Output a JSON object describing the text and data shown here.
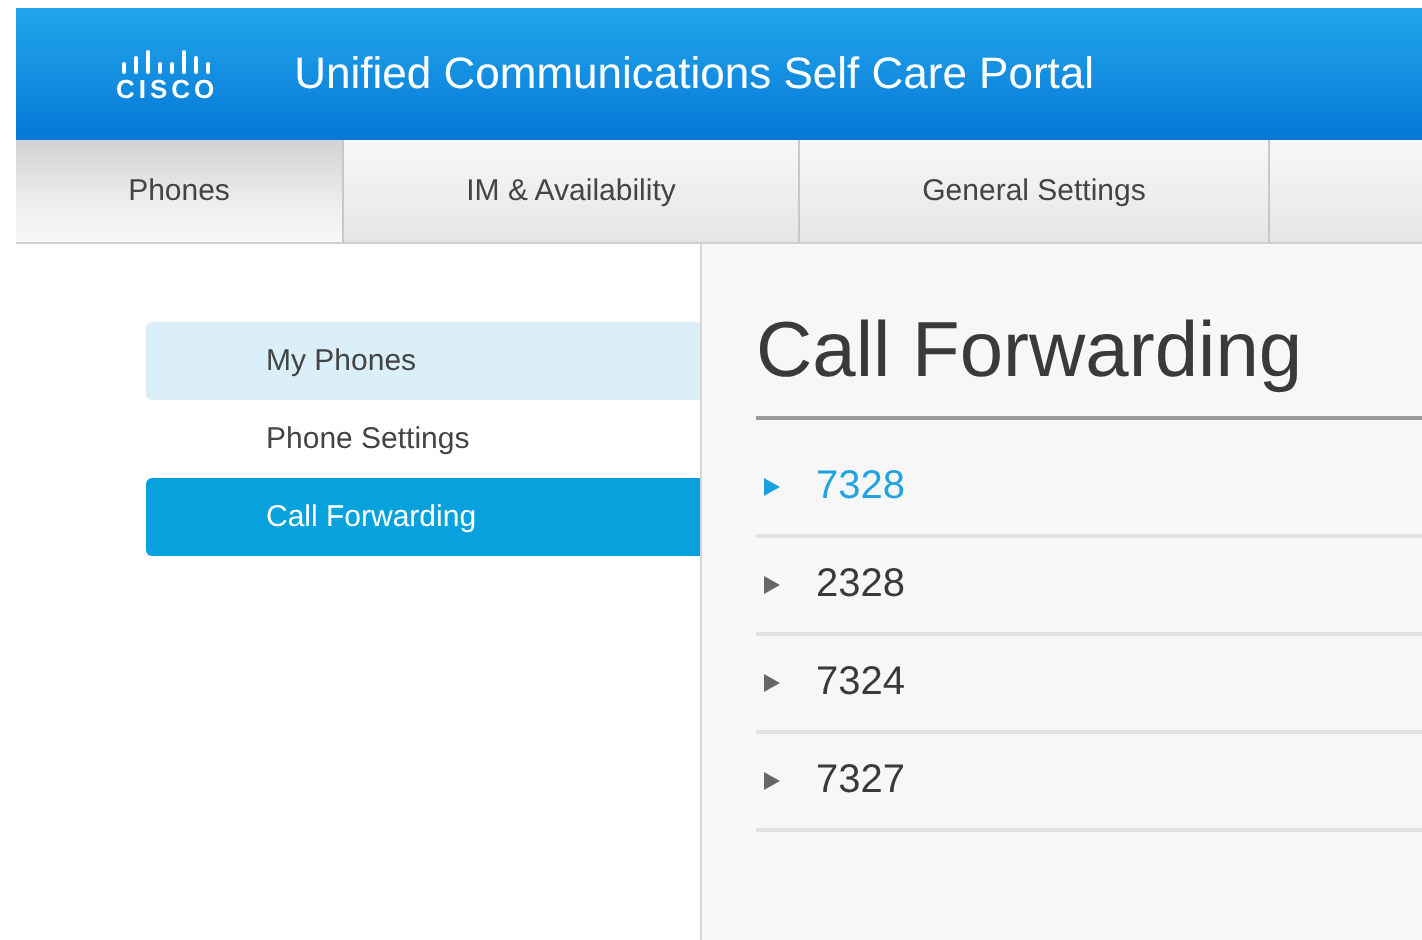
{
  "header": {
    "logo_text": "CISCO",
    "title": "Unified Communications Self Care Portal"
  },
  "tabs": [
    {
      "label": "Phones",
      "selected": true
    },
    {
      "label": "IM & Availability",
      "selected": false
    },
    {
      "label": "General Settings",
      "selected": false
    }
  ],
  "sidebar": {
    "items": [
      {
        "label": "My Phones",
        "selected": false,
        "highlighted": true
      },
      {
        "label": "Phone Settings",
        "selected": false,
        "highlighted": false
      },
      {
        "label": "Call Forwarding",
        "selected": true,
        "highlighted": false
      }
    ]
  },
  "content": {
    "heading": "Call Forwarding",
    "lines": [
      {
        "number": "7328",
        "selected": true
      },
      {
        "number": "2328",
        "selected": false
      },
      {
        "number": "7324",
        "selected": false
      },
      {
        "number": "7327",
        "selected": false
      }
    ]
  }
}
